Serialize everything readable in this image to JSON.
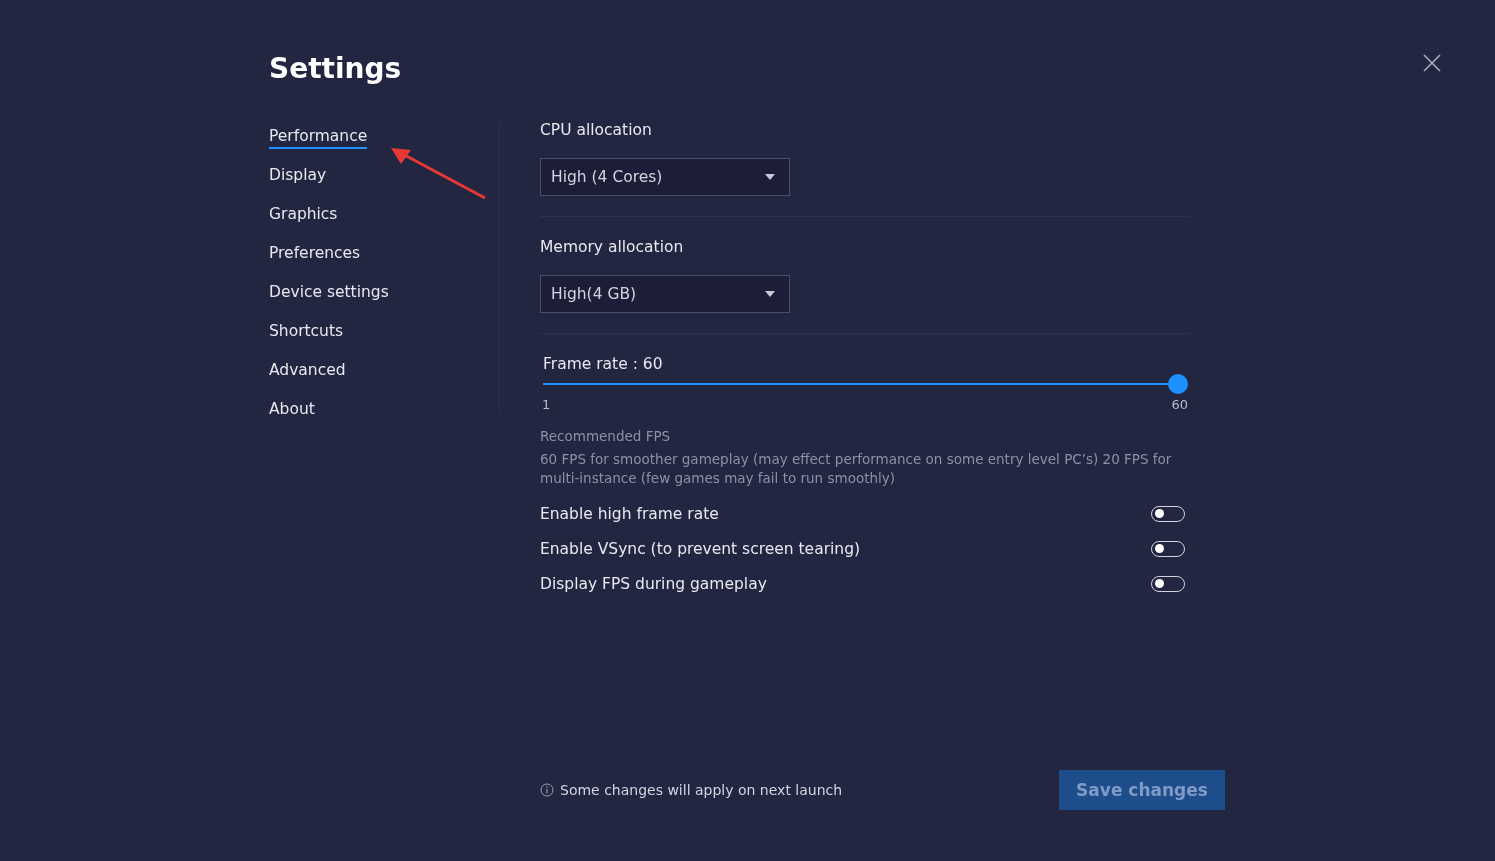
{
  "title": "Settings",
  "nav": [
    {
      "label": "Performance",
      "selected": true
    },
    {
      "label": "Display",
      "selected": false
    },
    {
      "label": "Graphics",
      "selected": false
    },
    {
      "label": "Preferences",
      "selected": false
    },
    {
      "label": "Device settings",
      "selected": false
    },
    {
      "label": "Shortcuts",
      "selected": false
    },
    {
      "label": "Advanced",
      "selected": false
    },
    {
      "label": "About",
      "selected": false
    }
  ],
  "dropdowns": [
    {
      "label": "CPU allocation",
      "value": "High (4 Cores)"
    },
    {
      "label": "Memory allocation",
      "value": "High(4 GB)"
    }
  ],
  "frame_rate": {
    "label": "Frame rate : 60",
    "level": 1,
    "min": "1",
    "max": "60"
  },
  "recommended": {
    "title": "Recommended FPS",
    "text": "60 FPS for smoother gameplay (may effect performance on some entry level PC’s) 20 FPS for multi-instance (few games may fail to run smoothly)"
  },
  "toggles": [
    {
      "label": "Enable high frame rate",
      "on": false
    },
    {
      "label": "Enable VSync (to prevent screen tearing)",
      "on": false
    },
    {
      "label": "Display FPS during gameplay",
      "on": false
    }
  ],
  "footer": {
    "note": "Some changes will apply on next launch",
    "button": {
      "label": "Save changes",
      "disabled": true
    }
  }
}
